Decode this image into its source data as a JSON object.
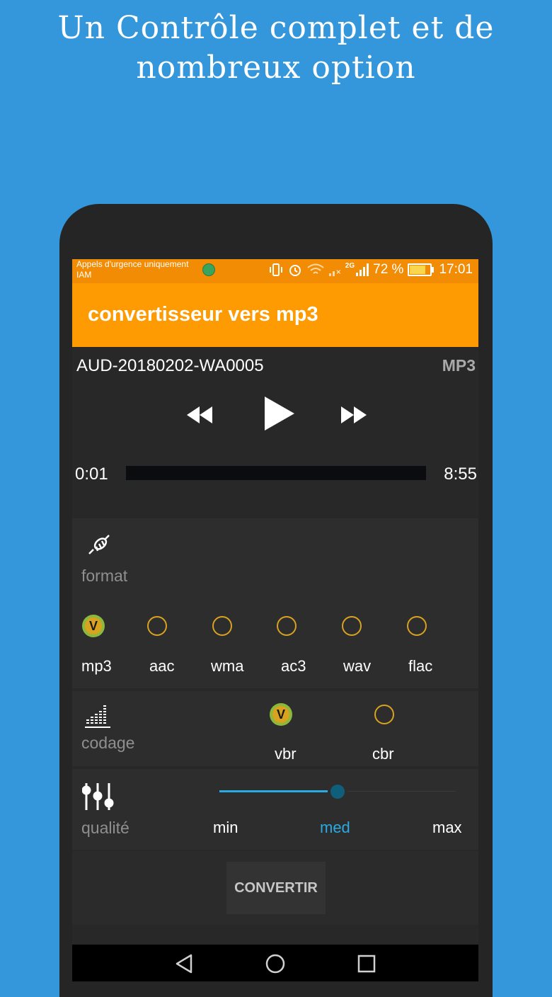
{
  "headline": {
    "line1": "Un Contrôle complet et de",
    "line2": "nombreux option"
  },
  "status_bar": {
    "carrier_line1": "Appels d'urgence uniquement",
    "carrier_line2": "IAM",
    "network": "2G",
    "battery_percent": "72 %",
    "battery_level": 0.72,
    "time": "17:01"
  },
  "app_bar": {
    "title": "convertisseur vers mp3"
  },
  "player": {
    "file_name": "AUD-20180202-WA0005",
    "format": "MP3",
    "current_time": "0:01",
    "total_time": "8:55"
  },
  "format_section": {
    "label": "format",
    "options": [
      "mp3",
      "aac",
      "wma",
      "ac3",
      "wav",
      "flac"
    ],
    "selected": "mp3",
    "check_mark": "V"
  },
  "codage_section": {
    "label": "codage",
    "options": [
      "vbr",
      "cbr"
    ],
    "selected": "vbr",
    "check_mark": "V"
  },
  "qualite_section": {
    "label": "qualité",
    "levels": [
      "min",
      "med",
      "max"
    ],
    "selected": "med",
    "slider_value": 0.5
  },
  "convert_button": {
    "label": "CONVERTIR"
  },
  "colors": {
    "background": "#3497db",
    "app_bar": "#fe9a02",
    "status_bar": "#f28c05",
    "radio_ring": "#d9a21f",
    "radio_check": "#8cb83c",
    "accent_blue": "#29abe2"
  }
}
